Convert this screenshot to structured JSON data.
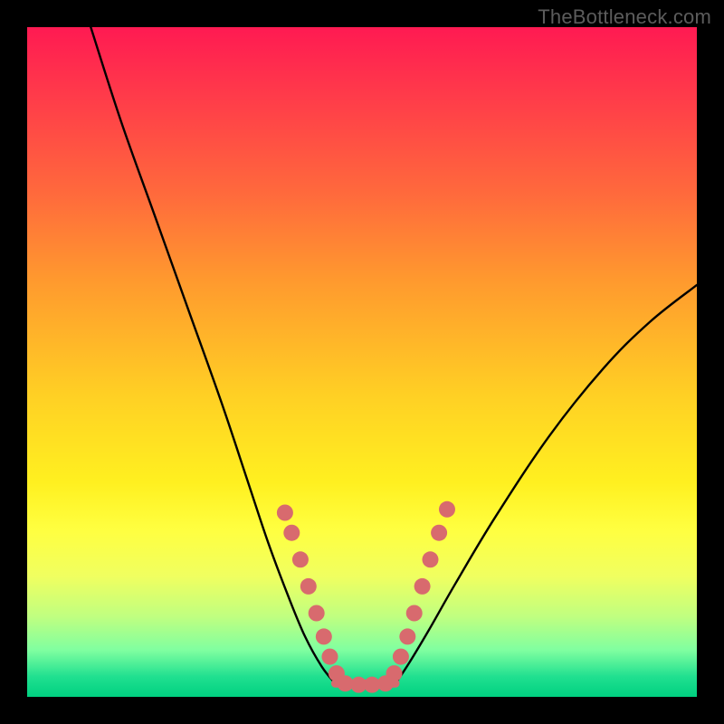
{
  "watermark": "TheBottleneck.com",
  "chart_data": {
    "type": "line",
    "title": "",
    "xlabel": "",
    "ylabel": "",
    "xlim": [
      0,
      1
    ],
    "ylim": [
      0,
      1
    ],
    "annotations": [],
    "series": [
      {
        "name": "left-curve",
        "stroke": "#000000",
        "x": [
          0.095,
          0.14,
          0.19,
          0.24,
          0.29,
          0.33,
          0.36,
          0.39,
          0.415,
          0.44,
          0.46
        ],
        "y": [
          1.0,
          0.86,
          0.72,
          0.58,
          0.44,
          0.32,
          0.23,
          0.15,
          0.09,
          0.045,
          0.02
        ]
      },
      {
        "name": "right-curve",
        "stroke": "#000000",
        "x": [
          0.55,
          0.57,
          0.6,
          0.64,
          0.7,
          0.78,
          0.86,
          0.93,
          1.0
        ],
        "y": [
          0.02,
          0.05,
          0.1,
          0.17,
          0.27,
          0.39,
          0.49,
          0.56,
          0.615
        ]
      },
      {
        "name": "floor",
        "stroke": "#d86a6e",
        "x": [
          0.46,
          0.55
        ],
        "y": [
          0.02,
          0.02
        ]
      }
    ],
    "markers": {
      "name": "dots",
      "color": "#d86a6e",
      "radius_px": 9,
      "points": [
        {
          "x": 0.385,
          "y": 0.275
        },
        {
          "x": 0.395,
          "y": 0.245
        },
        {
          "x": 0.408,
          "y": 0.205
        },
        {
          "x": 0.42,
          "y": 0.165
        },
        {
          "x": 0.432,
          "y": 0.125
        },
        {
          "x": 0.443,
          "y": 0.09
        },
        {
          "x": 0.452,
          "y": 0.06
        },
        {
          "x": 0.462,
          "y": 0.035
        },
        {
          "x": 0.475,
          "y": 0.02
        },
        {
          "x": 0.495,
          "y": 0.018
        },
        {
          "x": 0.515,
          "y": 0.018
        },
        {
          "x": 0.535,
          "y": 0.02
        },
        {
          "x": 0.548,
          "y": 0.035
        },
        {
          "x": 0.558,
          "y": 0.06
        },
        {
          "x": 0.568,
          "y": 0.09
        },
        {
          "x": 0.578,
          "y": 0.125
        },
        {
          "x": 0.59,
          "y": 0.165
        },
        {
          "x": 0.602,
          "y": 0.205
        },
        {
          "x": 0.615,
          "y": 0.245
        },
        {
          "x": 0.627,
          "y": 0.28
        }
      ]
    },
    "colors": {
      "gradient_top": "#ff1a52",
      "gradient_bottom": "#00d080",
      "marker": "#d86a6e",
      "curve": "#000000",
      "frame": "#000000"
    }
  }
}
